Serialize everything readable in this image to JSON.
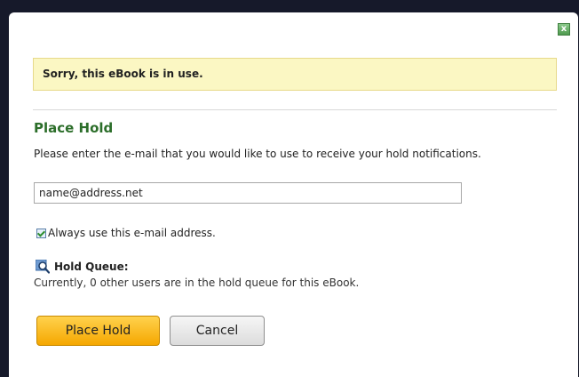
{
  "dialog": {
    "close_glyph": "x",
    "alert_message": "Sorry, this eBook is in use.",
    "title": "Place Hold",
    "instructions": "Please enter the e-mail that you would like to use to receive your hold notifications.",
    "email": {
      "value": "name@address.net"
    },
    "always_use_email": {
      "checked": true,
      "label": "Always use this e-mail address."
    },
    "hold_queue": {
      "icon": "magnifier-icon",
      "title": "Hold Queue:",
      "text": "Currently, 0 other users are in the hold queue for this eBook."
    },
    "buttons": {
      "place_hold": "Place Hold",
      "cancel": "Cancel"
    }
  },
  "colors": {
    "title_green": "#2c6e2a",
    "alert_background": "#fbf7c3",
    "primary_button": "#f5a700",
    "backdrop": "#16192a"
  }
}
